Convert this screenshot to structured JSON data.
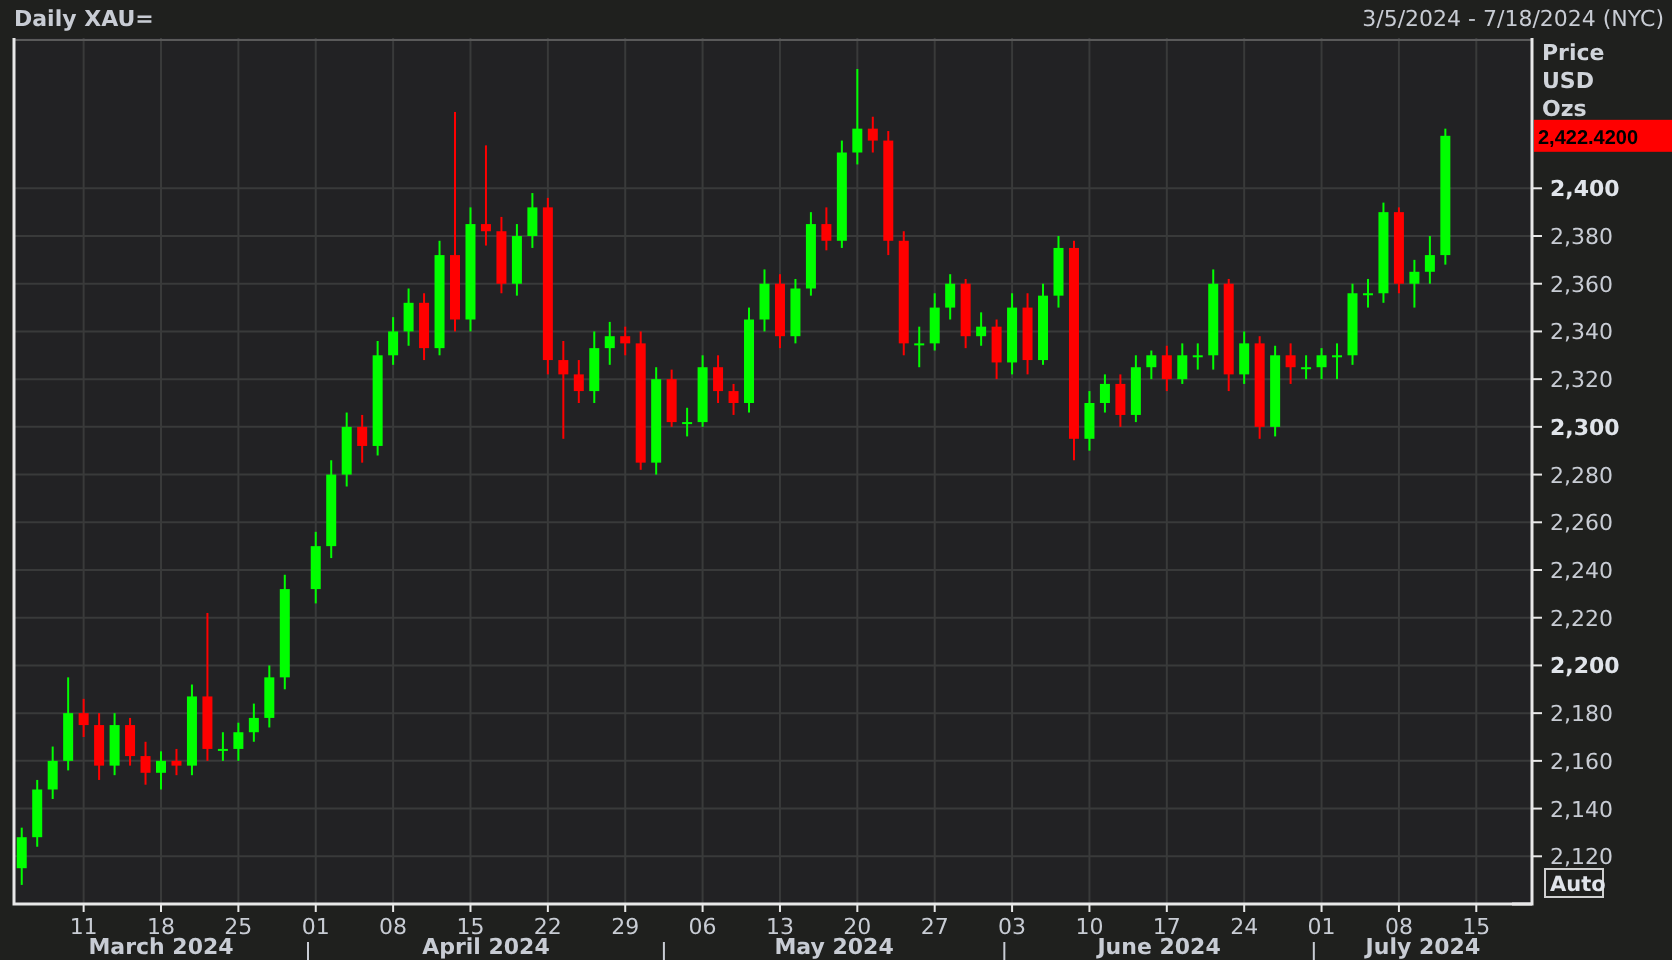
{
  "header": {
    "title": "Daily XAU=",
    "date_range": "3/5/2024 - 7/18/2024 (NYC)"
  },
  "price_axis": {
    "heading": [
      "Price",
      "USD",
      "Ozs"
    ],
    "current_price": "2,422.4200",
    "scale_button": "Auto"
  },
  "month_labels": [
    "March 2024",
    "April 2024",
    "May 2024",
    "June 2024",
    "July 2024"
  ],
  "chart": {
    "chart_data": {
      "type": "candlestick",
      "grid": true,
      "ylim": [
        2100,
        2463
      ],
      "categories": [
        null,
        null,
        null,
        null,
        "11",
        null,
        null,
        null,
        null,
        "18",
        null,
        null,
        null,
        null,
        "25",
        null,
        null,
        null,
        null,
        "01",
        null,
        null,
        null,
        null,
        "08",
        null,
        null,
        null,
        null,
        "15",
        null,
        null,
        null,
        null,
        "22",
        null,
        null,
        null,
        null,
        "29",
        null,
        null,
        null,
        null,
        "06",
        null,
        null,
        null,
        null,
        "13",
        null,
        null,
        null,
        null,
        "20",
        null,
        null,
        null,
        null,
        "27",
        null,
        null,
        null,
        null,
        "03",
        null,
        null,
        null,
        null,
        "10",
        null,
        null,
        null,
        null,
        "17",
        null,
        null,
        null,
        null,
        "24",
        null,
        null,
        null,
        null,
        "01",
        null,
        null,
        null,
        null,
        "08",
        null,
        null,
        null,
        null,
        "15"
      ],
      "yticks": [
        {
          "value": 2120,
          "label": "2,120"
        },
        {
          "value": 2140,
          "label": "2,140"
        },
        {
          "value": 2160,
          "label": "2,160"
        },
        {
          "value": 2180,
          "label": "2,180"
        },
        {
          "value": 2200,
          "label": "2,200"
        },
        {
          "value": 2220,
          "label": "2,220"
        },
        {
          "value": 2240,
          "label": "2,240"
        },
        {
          "value": 2260,
          "label": "2,260"
        },
        {
          "value": 2280,
          "label": "2,280"
        },
        {
          "value": 2300,
          "label": "2,300"
        },
        {
          "value": 2320,
          "label": "2,320"
        },
        {
          "value": 2340,
          "label": "2,340"
        },
        {
          "value": 2360,
          "label": "2,360"
        },
        {
          "value": 2380,
          "label": "2,380"
        },
        {
          "value": 2400,
          "label": "2,400"
        }
      ],
      "ohlc": [
        [
          2115,
          2132,
          2108,
          2128
        ],
        [
          2128,
          2152,
          2124,
          2148
        ],
        [
          2148,
          2166,
          2144,
          2160
        ],
        [
          2160,
          2195,
          2156,
          2180
        ],
        [
          2180,
          2186,
          2170,
          2175
        ],
        [
          2175,
          2180,
          2152,
          2158
        ],
        [
          2158,
          2180,
          2154,
          2175
        ],
        [
          2175,
          2178,
          2158,
          2162
        ],
        [
          2162,
          2168,
          2150,
          2155
        ],
        [
          2155,
          2164,
          2148,
          2160
        ],
        [
          2160,
          2165,
          2154,
          2158
        ],
        [
          2158,
          2192,
          2154,
          2187
        ],
        [
          2187,
          2222,
          2160,
          2165
        ],
        [
          2165,
          2172,
          2160,
          2165
        ],
        [
          2165,
          2176,
          2160,
          2172
        ],
        [
          2172,
          2184,
          2168,
          2178
        ],
        [
          2178,
          2200,
          2174,
          2195
        ],
        [
          2195,
          2238,
          2190,
          2232
        ],
        null,
        [
          2232,
          2256,
          2226,
          2250
        ],
        [
          2250,
          2286,
          2245,
          2280
        ],
        [
          2280,
          2306,
          2275,
          2300
        ],
        [
          2300,
          2305,
          2285,
          2292
        ],
        [
          2292,
          2336,
          2288,
          2330
        ],
        [
          2330,
          2346,
          2326,
          2340
        ],
        [
          2340,
          2358,
          2334,
          2352
        ],
        [
          2352,
          2356,
          2328,
          2333
        ],
        [
          2333,
          2378,
          2330,
          2372
        ],
        [
          2372,
          2432,
          2340,
          2345
        ],
        [
          2345,
          2392,
          2340,
          2385
        ],
        [
          2385,
          2418,
          2376,
          2382
        ],
        [
          2382,
          2388,
          2356,
          2360
        ],
        [
          2360,
          2385,
          2355,
          2380
        ],
        [
          2380,
          2398,
          2375,
          2392
        ],
        [
          2392,
          2396,
          2322,
          2328
        ],
        [
          2328,
          2336,
          2295,
          2322
        ],
        [
          2322,
          2328,
          2310,
          2315
        ],
        [
          2315,
          2340,
          2310,
          2333
        ],
        [
          2333,
          2344,
          2326,
          2338
        ],
        [
          2338,
          2342,
          2330,
          2335
        ],
        [
          2335,
          2340,
          2282,
          2285
        ],
        [
          2285,
          2325,
          2280,
          2320
        ],
        [
          2320,
          2324,
          2300,
          2302
        ],
        [
          2302,
          2308,
          2296,
          2302
        ],
        [
          2302,
          2330,
          2300,
          2325
        ],
        [
          2325,
          2330,
          2310,
          2315
        ],
        [
          2315,
          2318,
          2305,
          2310
        ],
        [
          2310,
          2350,
          2306,
          2345
        ],
        [
          2345,
          2366,
          2340,
          2360
        ],
        [
          2360,
          2364,
          2333,
          2338
        ],
        [
          2338,
          2362,
          2335,
          2358
        ],
        [
          2358,
          2390,
          2355,
          2385
        ],
        [
          2385,
          2392,
          2374,
          2378
        ],
        [
          2378,
          2420,
          2375,
          2415
        ],
        [
          2415,
          2450,
          2410,
          2425
        ],
        [
          2425,
          2430,
          2415,
          2420
        ],
        [
          2420,
          2424,
          2372,
          2378
        ],
        [
          2378,
          2382,
          2330,
          2335
        ],
        [
          2335,
          2342,
          2325,
          2335
        ],
        [
          2335,
          2356,
          2332,
          2350
        ],
        [
          2350,
          2364,
          2345,
          2360
        ],
        [
          2360,
          2362,
          2333,
          2338
        ],
        [
          2338,
          2348,
          2334,
          2342
        ],
        [
          2342,
          2345,
          2320,
          2327
        ],
        [
          2327,
          2356,
          2322,
          2350
        ],
        [
          2350,
          2356,
          2322,
          2328
        ],
        [
          2328,
          2360,
          2326,
          2355
        ],
        [
          2355,
          2380,
          2350,
          2375
        ],
        [
          2375,
          2378,
          2286,
          2295
        ],
        [
          2295,
          2315,
          2290,
          2310
        ],
        [
          2310,
          2322,
          2306,
          2318
        ],
        [
          2318,
          2322,
          2300,
          2305
        ],
        [
          2305,
          2330,
          2302,
          2325
        ],
        [
          2325,
          2332,
          2320,
          2330
        ],
        [
          2330,
          2334,
          2315,
          2320
        ],
        [
          2320,
          2335,
          2318,
          2330
        ],
        [
          2330,
          2335,
          2324,
          2330
        ],
        [
          2330,
          2366,
          2324,
          2360
        ],
        [
          2360,
          2362,
          2315,
          2322
        ],
        [
          2322,
          2340,
          2318,
          2335
        ],
        [
          2335,
          2338,
          2295,
          2300
        ],
        [
          2300,
          2334,
          2296,
          2330
        ],
        [
          2330,
          2335,
          2318,
          2325
        ],
        [
          2325,
          2330,
          2320,
          2325
        ],
        [
          2325,
          2333,
          2320,
          2330
        ],
        [
          2330,
          2335,
          2320,
          2330
        ],
        [
          2330,
          2360,
          2326,
          2356
        ],
        [
          2356,
          2362,
          2350,
          2356
        ],
        [
          2356,
          2394,
          2352,
          2390
        ],
        [
          2390,
          2392,
          2356,
          2360
        ],
        [
          2360,
          2370,
          2350,
          2365
        ],
        [
          2365,
          2380,
          2360,
          2372
        ],
        [
          2372,
          2425,
          2368,
          2422
        ],
        null,
        null
      ]
    }
  }
}
